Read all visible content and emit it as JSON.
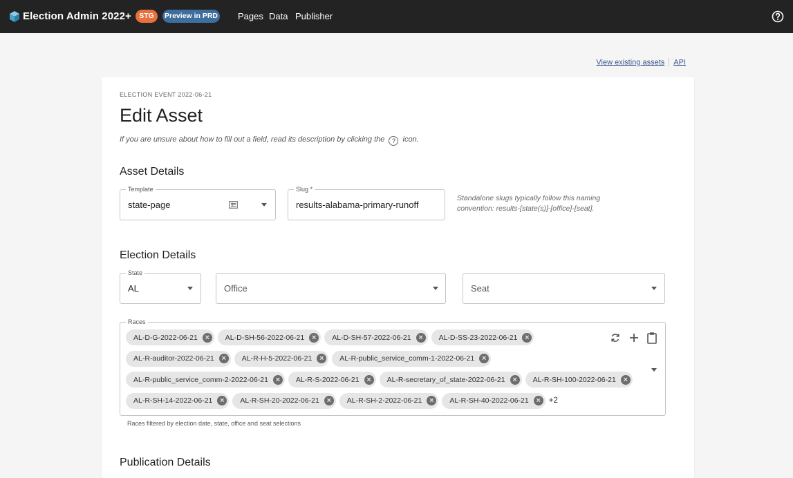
{
  "header": {
    "app_title": "Election Admin 2022+",
    "env_badge": "STG",
    "preview_badge": "Preview in PRD",
    "nav": [
      "Pages",
      "Data",
      "Publisher"
    ],
    "help_icon": "help-circle-icon",
    "background_color": "#232323",
    "stg_color": "#e8703a",
    "prd_color": "#3e6e9e"
  },
  "links": {
    "view_assets": "View existing assets",
    "api": "API"
  },
  "form": {
    "event_label": "ELECTION EVENT 2022-06-21",
    "title": "Edit Asset",
    "hint_before": "If you are unsure about how to fill out a field, read its description by clicking the",
    "hint_icon": "?",
    "hint_after": "icon.",
    "asset_details": {
      "title": "Asset Details",
      "template_label": "Template",
      "template_value": "state-page",
      "slug_label": "Slug *",
      "slug_value": "results-alabama-primary-runoff",
      "slug_note": "Standalone slugs typically follow this naming convention: results-[state(s)]-[office]-[seat]."
    },
    "election_details": {
      "title": "Election Details",
      "state_label": "State",
      "state_value": "AL",
      "office_placeholder": "Office",
      "seat_placeholder": "Seat",
      "races_label": "Races",
      "races": [
        "AL-D-G-2022-06-21",
        "AL-D-SH-56-2022-06-21",
        "AL-D-SH-57-2022-06-21",
        "AL-D-SS-23-2022-06-21",
        "AL-R-auditor-2022-06-21",
        "AL-R-H-5-2022-06-21",
        "AL-R-public_service_comm-1-2022-06-21",
        "AL-R-public_service_comm-2-2022-06-21",
        "AL-R-S-2022-06-21",
        "AL-R-secretary_of_state-2022-06-21",
        "AL-R-SH-100-2022-06-21",
        "AL-R-SH-14-2022-06-21",
        "AL-R-SH-20-2022-06-21",
        "AL-R-SH-2-2022-06-21",
        "AL-R-SH-40-2022-06-21"
      ],
      "races_more": "+2",
      "races_helper": "Races filtered by election date, state, office and seat selections"
    },
    "publication_details": {
      "title": "Publication Details"
    }
  }
}
